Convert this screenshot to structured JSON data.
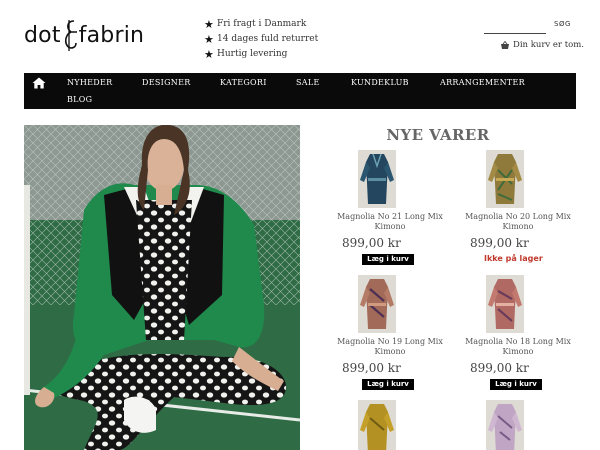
{
  "brand": {
    "logo_left": "dot",
    "logo_right": "fabrin"
  },
  "usps": [
    "Fri fragt i Danmark",
    "14 dages fuld returret",
    "Hurtig levering"
  ],
  "search": {
    "button_label": "SØG",
    "value": ""
  },
  "cart": {
    "status": "Din kurv er tom."
  },
  "nav": {
    "items": [
      "NYHEDER",
      "DESIGNER",
      "KATEGORI",
      "SALE",
      "KUNDEKLUB",
      "ARRANGEMENTER",
      "BLOG"
    ]
  },
  "main": {
    "section_title": "NYE VARER",
    "products": [
      {
        "name": "Magnolia No 21 Long Mix Kimono",
        "price": "899,00 kr",
        "action": "Læg i kurv",
        "stock_status": ""
      },
      {
        "name": "Magnolia No 20 Long Mix Kimono",
        "price": "899,00 kr",
        "action": "",
        "stock_status": "Ikke på lager"
      },
      {
        "name": "Magnolia No 19 Long Mix Kimono",
        "price": "899,00 kr",
        "action": "Læg i kurv",
        "stock_status": ""
      },
      {
        "name": "Magnolia No 18 Long Mix Kimono",
        "price": "899,00 kr",
        "action": "Læg i kurv",
        "stock_status": ""
      },
      {
        "name": "",
        "price": "",
        "action": "",
        "stock_status": ""
      },
      {
        "name": "",
        "price": "",
        "action": "",
        "stock_status": ""
      }
    ]
  },
  "colors": {
    "nav_background": "#0a0a0a",
    "out_of_stock": "#c0392b",
    "jacket_green": "#1f8a4c"
  }
}
